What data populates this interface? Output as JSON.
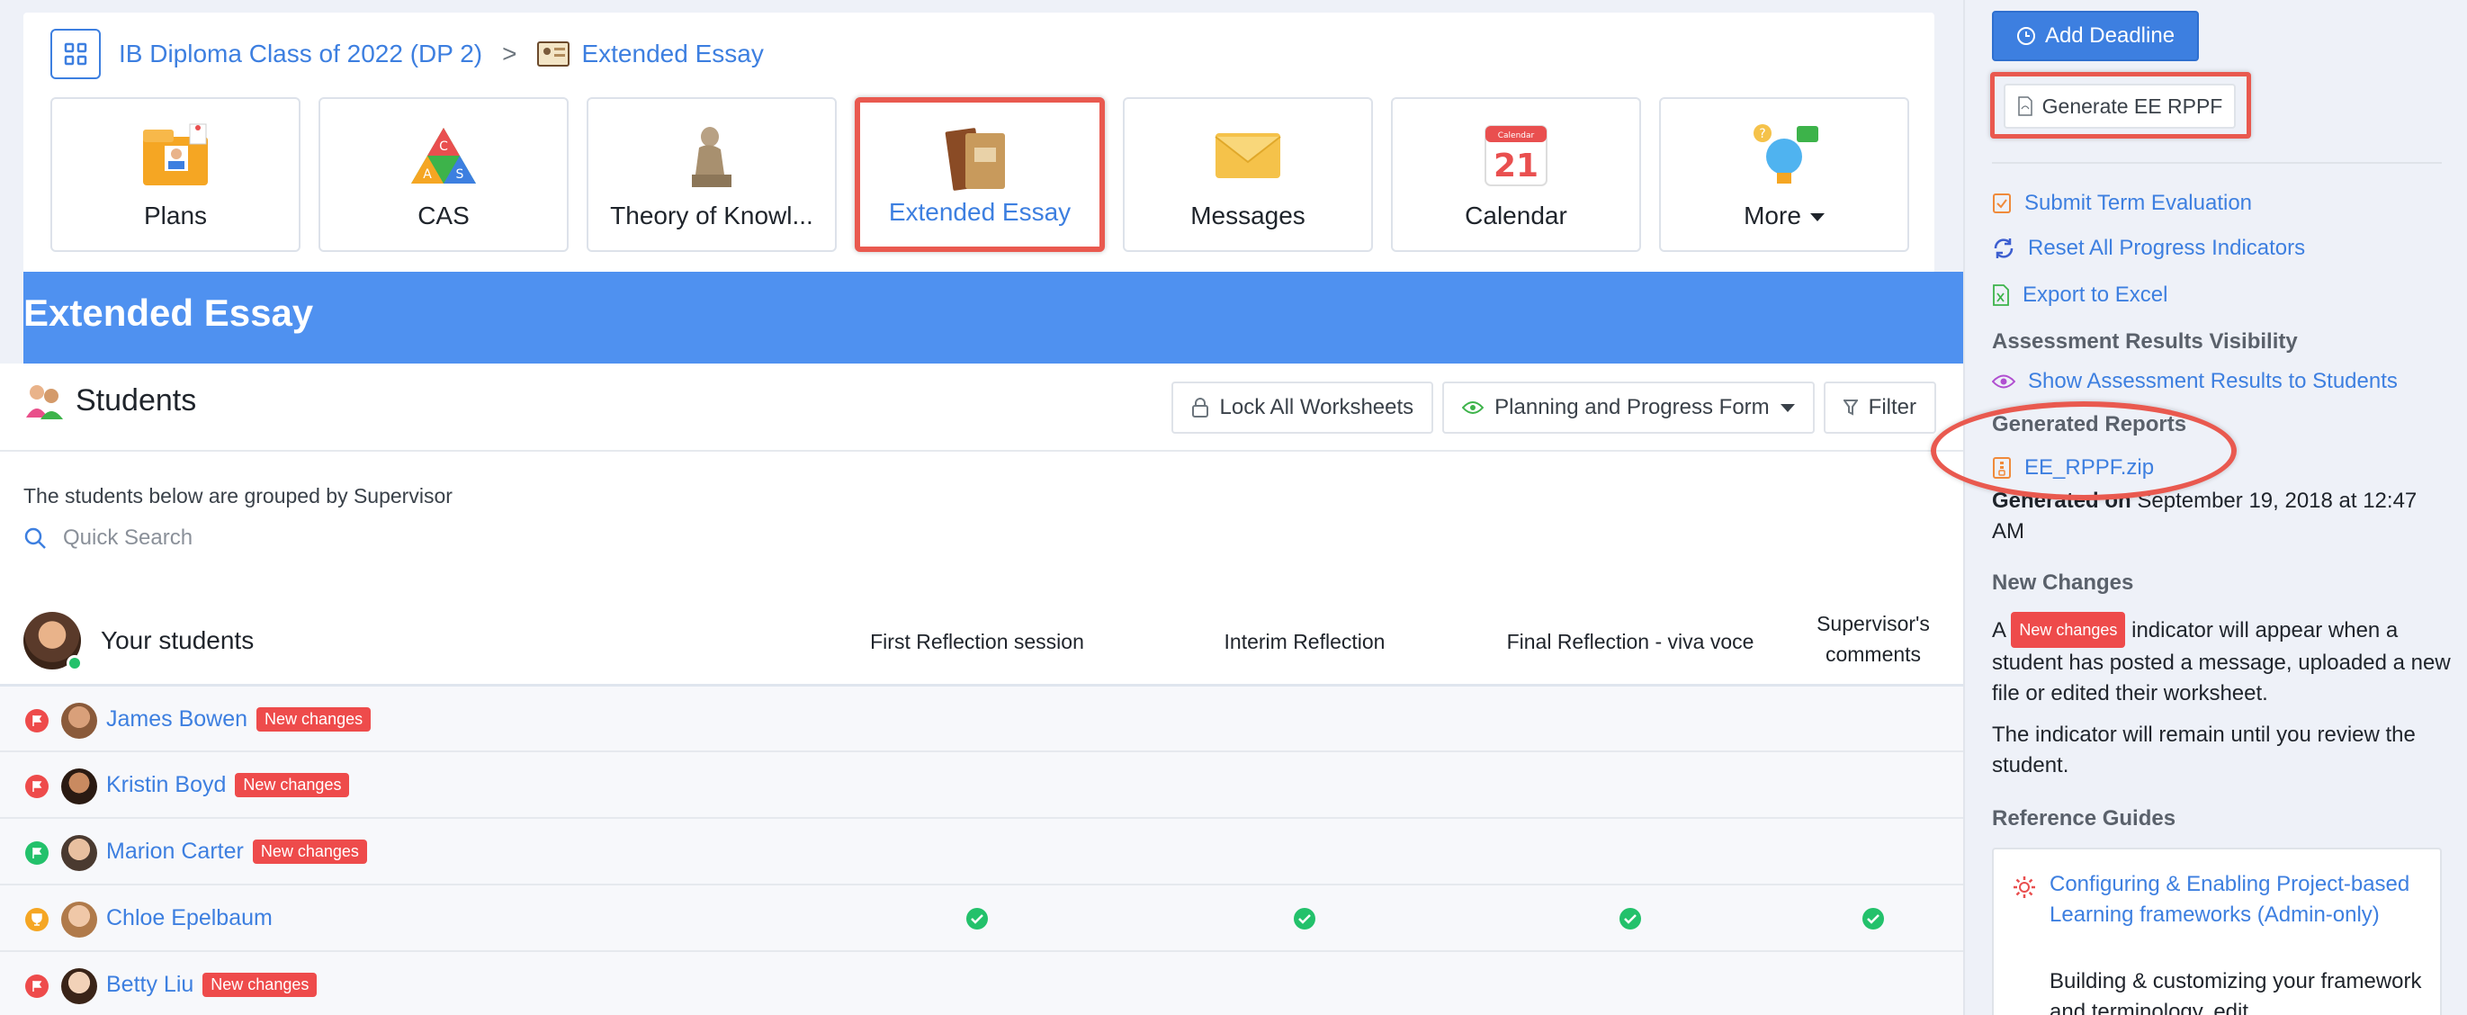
{
  "breadcrumb": {
    "class_name": "IB Diploma Class of 2022 (DP 2)",
    "separator": ">",
    "current": "Extended Essay"
  },
  "tiles": [
    {
      "label": "Plans",
      "icon": "plans-icon"
    },
    {
      "label": "CAS",
      "icon": "cas-icon"
    },
    {
      "label": "Theory of Knowl...",
      "icon": "thinker-icon"
    },
    {
      "label": "Extended Essay",
      "icon": "books-icon",
      "active": true
    },
    {
      "label": "Messages",
      "icon": "envelope-icon"
    },
    {
      "label": "Calendar",
      "icon": "calendar-icon",
      "calendar_label": "Calendar",
      "calendar_day": "21"
    },
    {
      "label": "More",
      "icon": "lightbulb-icon"
    }
  ],
  "banner": {
    "title": "Extended Essay"
  },
  "students": {
    "title": "Students",
    "lock_button": "Lock All Worksheets",
    "form_button": "Planning and Progress Form",
    "filter_button": "Filter",
    "grouping_note": "The students below are grouped by Supervisor",
    "search_placeholder": "Quick Search",
    "group_label": "Your students",
    "columns": [
      "First Reflection session",
      "Interim Reflection",
      "Final Reflection - viva voce",
      "Supervisor's\ncomments"
    ],
    "rows": [
      {
        "name": "James Bowen",
        "badge": "New changes",
        "flag": "red",
        "checks": [
          false,
          false,
          false,
          false
        ]
      },
      {
        "name": "Kristin Boyd",
        "badge": "New changes",
        "flag": "red",
        "checks": [
          false,
          false,
          false,
          false
        ]
      },
      {
        "name": "Marion Carter",
        "badge": "New changes",
        "flag": "green",
        "checks": [
          false,
          false,
          false,
          false
        ]
      },
      {
        "name": "Chloe Epelbaum",
        "badge": "",
        "flag": "orange",
        "checks": [
          true,
          true,
          true,
          true
        ]
      },
      {
        "name": "Betty Liu",
        "badge": "New changes",
        "flag": "red",
        "checks": [
          false,
          false,
          false,
          false
        ]
      }
    ]
  },
  "sidebar": {
    "add_deadline": "Add Deadline",
    "generate": "Generate EE RPPF",
    "submit_term": "Submit Term Evaluation",
    "reset_progress": "Reset All Progress Indicators",
    "export_excel": "Export to Excel",
    "visibility_heading": "Assessment Results Visibility",
    "show_results": "Show Assessment Results to Students",
    "reports_heading": "Generated Reports",
    "report_file": "EE_RPPF.zip",
    "generated_on_label": "Generated on",
    "generated_on_value": " September 19, 2018 at 12:47 AM",
    "new_changes_heading": "New Changes",
    "nc_prefix": "A ",
    "nc_badge": "New changes",
    "nc_suffix": " indicator will appear when a student has posted a message, uploaded a new file or edited their worksheet.",
    "nc_remain": "The indicator will remain until you review the student.",
    "ref_heading": "Reference Guides",
    "ref_link": "Configuring & Enabling Project-based Learning frameworks (Admin-only)",
    "ref_desc": "Building & customizing your framework and terminology, edit..."
  },
  "colors": {
    "accent": "#3d7fe0",
    "banner": "#4f91f0",
    "highlight": "#e9594f",
    "badge": "#ee4b4b",
    "success": "#23c16b"
  }
}
